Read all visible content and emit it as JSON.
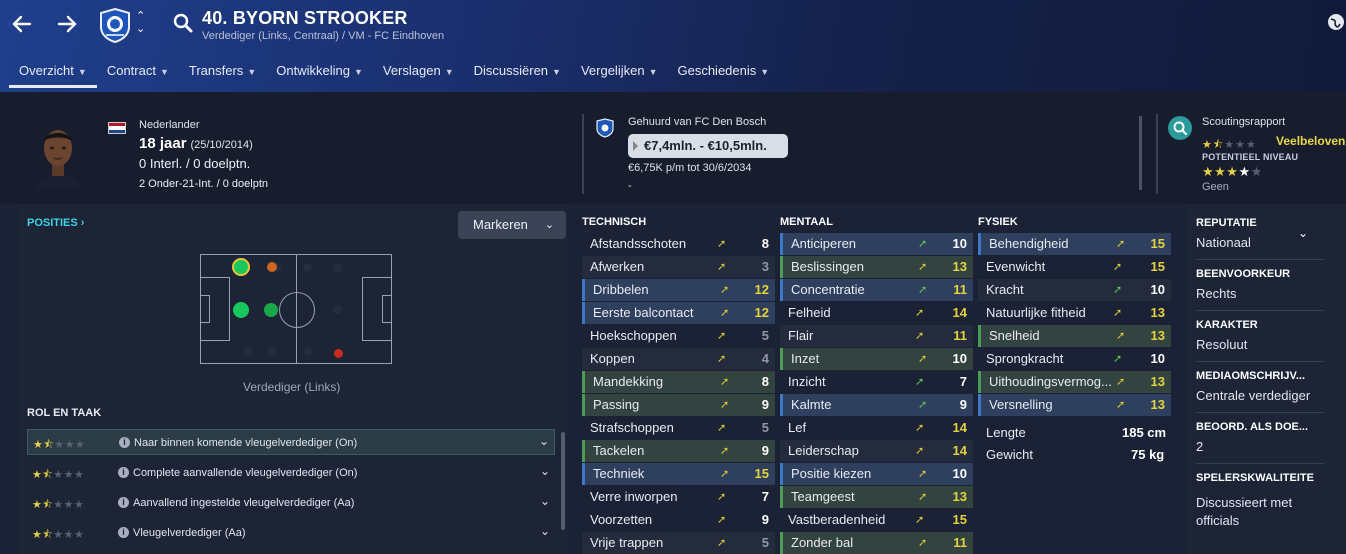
{
  "header": {
    "player_name": "40. BYORN STROOKER",
    "subtitle": "Verdediger (Links, Centraal) / VM - FC Eindhoven",
    "back_icon": "arrow-left-icon",
    "forward_icon": "arrow-right-icon",
    "club_switch_up": "⌃",
    "club_switch_down": "⌄"
  },
  "tabs": [
    {
      "label": "Overzicht",
      "active": true
    },
    {
      "label": "Contract"
    },
    {
      "label": "Transfers"
    },
    {
      "label": "Ontwikkeling"
    },
    {
      "label": "Verslagen"
    },
    {
      "label": "Discussiëren"
    },
    {
      "label": "Vergelijken"
    },
    {
      "label": "Geschiedenis"
    }
  ],
  "info": {
    "nationality": "Nederlander",
    "age": "18 jaar",
    "dob": "(25/10/2014)",
    "intl": "0 Interl. / 0 doelptn.",
    "u21": "2 Onder-21-Int. / 0 doelptn",
    "loan_from": "Gehuurd van FC Den Bosch",
    "value": "€7,4mln. - €10,5mln.",
    "wage": "€6,75K p/m tot 30/6/2034",
    "wage_extra": "-",
    "scout_title": "Scoutingsrapport",
    "scout_verdict": "Veelbelovend",
    "potential_label": "POTENTIEEL NIVEAU",
    "potential_sub": "Geen",
    "current_rating_stars": 1.5,
    "potential_stars": 3.5
  },
  "positions": {
    "link": "POSITIES ›",
    "mark_button": "Markeren",
    "caption": "Verdediger (Links)"
  },
  "roles": {
    "title": "ROL EN TAAK",
    "items": [
      {
        "label": "Naar binnen komende vleugelverdediger (On)",
        "stars": 1.5
      },
      {
        "label": "Complete aanvallende vleugelverdediger (On)",
        "stars": 1.5
      },
      {
        "label": "Aanvallend ingestelde vleugelverdediger (Aa)",
        "stars": 1.5
      },
      {
        "label": "Vleugelverdediger (Aa)",
        "stars": 1.5
      }
    ]
  },
  "attributes": {
    "technisch_title": "TECHNISCH",
    "mentaal_title": "MENTAAL",
    "fysiek_title": "FYSIEK",
    "technisch": [
      {
        "name": "Afstandsschoten",
        "value": 8
      },
      {
        "name": "Afwerken",
        "value": 3
      },
      {
        "name": "Dribbelen",
        "value": 12
      },
      {
        "name": "Eerste balcontact",
        "value": 12
      },
      {
        "name": "Hoekschoppen",
        "value": 5
      },
      {
        "name": "Koppen",
        "value": 4
      },
      {
        "name": "Mandekking",
        "value": 8
      },
      {
        "name": "Passing",
        "value": 9
      },
      {
        "name": "Strafschoppen",
        "value": 5
      },
      {
        "name": "Tackelen",
        "value": 9
      },
      {
        "name": "Techniek",
        "value": 15
      },
      {
        "name": "Verre inworpen",
        "value": 7
      },
      {
        "name": "Voorzetten",
        "value": 9
      },
      {
        "name": "Vrije trappen",
        "value": 5
      }
    ],
    "mentaal": [
      {
        "name": "Anticiperen",
        "value": 10
      },
      {
        "name": "Beslissingen",
        "value": 13
      },
      {
        "name": "Concentratie",
        "value": 11
      },
      {
        "name": "Felheid",
        "value": 14
      },
      {
        "name": "Flair",
        "value": 11
      },
      {
        "name": "Inzet",
        "value": 10
      },
      {
        "name": "Inzicht",
        "value": 7
      },
      {
        "name": "Kalmte",
        "value": 9
      },
      {
        "name": "Lef",
        "value": 14
      },
      {
        "name": "Leiderschap",
        "value": 14
      },
      {
        "name": "Positie kiezen",
        "value": 10
      },
      {
        "name": "Teamgeest",
        "value": 13
      },
      {
        "name": "Vastberadenheid",
        "value": 15
      },
      {
        "name": "Zonder bal",
        "value": 11
      }
    ],
    "fysiek": [
      {
        "name": "Behendigheid",
        "value": 15
      },
      {
        "name": "Evenwicht",
        "value": 15
      },
      {
        "name": "Kracht",
        "value": 10
      },
      {
        "name": "Natuurlijke fitheid",
        "value": 13
      },
      {
        "name": "Snelheid",
        "value": 13
      },
      {
        "name": "Sprongkracht",
        "value": 10
      },
      {
        "name": "Uithoudingsvermog...",
        "value": 13
      },
      {
        "name": "Versnelling",
        "value": 13
      }
    ],
    "lengte_label": "Lengte",
    "lengte_value": "185 cm",
    "gewicht_label": "Gewicht",
    "gewicht_value": "75 kg"
  },
  "right": {
    "reputatie_label": "REPUTATIE",
    "reputatie_value": "Nationaal",
    "beenvoorkeur_label": "BEENVOORKEUR",
    "beenvoorkeur_value": "Rechts",
    "karakter_label": "KARAKTER",
    "karakter_value": "Resoluut",
    "media_label": "MEDIAOMSCHRIJV...",
    "media_value": "Centrale verdediger",
    "beoord_label": "BEOORD. ALS DOE...",
    "beoord_value": "2",
    "speler_label": "SPELERSKWALITEITE",
    "speler_value": "Discussieert met officials"
  },
  "colors": {
    "accent_cyan": "#3fd3e6",
    "attr_yellow": "#e4d33d",
    "attr_green": "#62c353",
    "star_gold": "#e7cf44"
  }
}
